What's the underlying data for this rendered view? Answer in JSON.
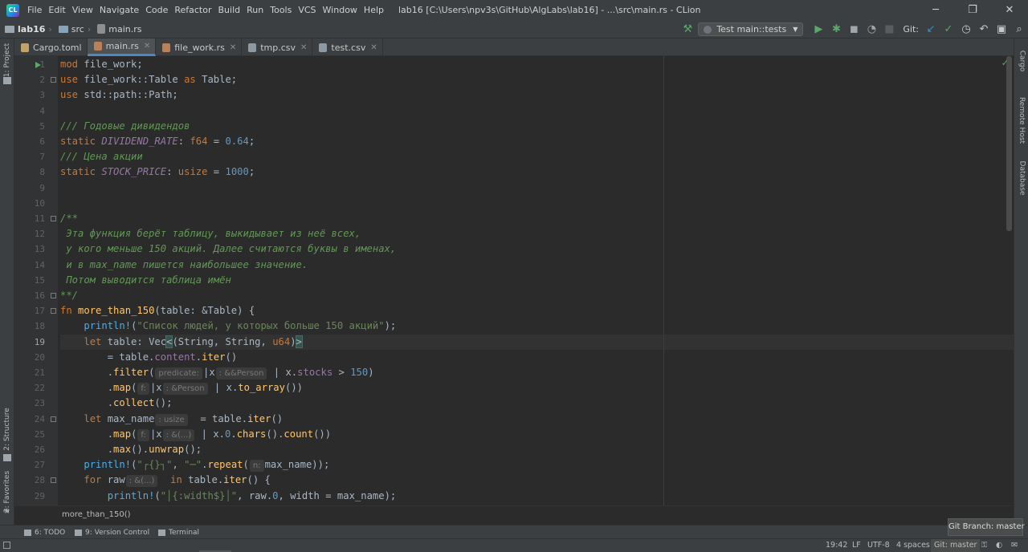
{
  "window": {
    "menus": [
      "File",
      "Edit",
      "View",
      "Navigate",
      "Code",
      "Refactor",
      "Build",
      "Run",
      "Tools",
      "VCS",
      "Window",
      "Help"
    ],
    "title": "lab16 [C:\\Users\\npv3s\\GitHub\\AlgLabs\\lab16] - ...\\src\\main.rs - CLion"
  },
  "navbar": {
    "project": "lab16",
    "folder": "src",
    "file": "main.rs",
    "run_config": "Test main::tests",
    "git_label": "Git:"
  },
  "tabs": [
    {
      "label": "Cargo.toml",
      "type": "toml"
    },
    {
      "label": "main.rs",
      "type": "rs",
      "active": true
    },
    {
      "label": "file_work.rs",
      "type": "rs"
    },
    {
      "label": "tmp.csv",
      "type": "csv"
    },
    {
      "label": "test.csv",
      "type": "csv"
    }
  ],
  "left_tools": [
    "1: Project",
    "2: Structure",
    "2: Favorites"
  ],
  "right_tools": [
    "Cargo",
    "Remote Host",
    "Database"
  ],
  "editor": {
    "current_line": 19,
    "line_numbers": [
      "1",
      "2",
      "3",
      "4",
      "5",
      "6",
      "7",
      "8",
      "9",
      "10",
      "11",
      "12",
      "13",
      "14",
      "15",
      "16",
      "17",
      "18",
      "19",
      "20",
      "21",
      "22",
      "23",
      "24",
      "25",
      "26",
      "27",
      "28",
      "29"
    ],
    "lines": [
      [
        {
          "t": "mod",
          "c": "kw"
        },
        {
          "t": " file_work;"
        }
      ],
      [
        {
          "t": "use",
          "c": "kw"
        },
        {
          "t": " file_work::Table "
        },
        {
          "t": "as",
          "c": "kw"
        },
        {
          "t": " Table;"
        }
      ],
      [
        {
          "t": "use",
          "c": "kw"
        },
        {
          "t": " std::path::Path;"
        }
      ],
      [],
      [
        {
          "t": "/// Годовые дивидендов",
          "c": "cmt"
        }
      ],
      [
        {
          "t": "static",
          "c": "kw"
        },
        {
          "t": " "
        },
        {
          "t": "DIVIDEND_RATE",
          "c": "stat"
        },
        {
          "t": ": "
        },
        {
          "t": "f64",
          "c": "kw"
        },
        {
          "t": " = "
        },
        {
          "t": "0.64",
          "c": "num"
        },
        {
          "t": ";"
        }
      ],
      [
        {
          "t": "/// Цена акции",
          "c": "cmt"
        }
      ],
      [
        {
          "t": "static",
          "c": "kw"
        },
        {
          "t": " "
        },
        {
          "t": "STOCK_PRICE",
          "c": "stat"
        },
        {
          "t": ": "
        },
        {
          "t": "usize",
          "c": "kw"
        },
        {
          "t": " = "
        },
        {
          "t": "1000",
          "c": "num"
        },
        {
          "t": ";"
        }
      ],
      [],
      [],
      [
        {
          "t": "/**",
          "c": "cmt"
        }
      ],
      [
        {
          "t": " Эта функция берёт таблицу, выкидывает из неё всех,",
          "c": "cmt"
        }
      ],
      [
        {
          "t": " у кого меньше 150 акций. Далее считаются буквы в именах,",
          "c": "cmt"
        }
      ],
      [
        {
          "t": " и в max_name пишется наибольшее значение.",
          "c": "cmt"
        }
      ],
      [
        {
          "t": " Потом выводится таблица имён",
          "c": "cmt"
        }
      ],
      [
        {
          "t": "**/",
          "c": "cmt"
        }
      ],
      [
        {
          "t": "fn",
          "c": "kw"
        },
        {
          "t": " "
        },
        {
          "t": "more_than_150",
          "c": "fn"
        },
        {
          "t": "(table: &Table) {"
        }
      ],
      [
        {
          "t": "    "
        },
        {
          "t": "println!",
          "c": "mac"
        },
        {
          "t": "("
        },
        {
          "t": "\"Список людей, у которых больше 150 акций\"",
          "c": "str"
        },
        {
          "t": ");"
        }
      ],
      [
        {
          "t": "    "
        },
        {
          "t": "let",
          "c": "kw"
        },
        {
          "t": " table: Vec"
        },
        {
          "t": "<",
          "c": "brace"
        },
        {
          "t": "(String, String, "
        },
        {
          "t": "u64",
          "c": "kw"
        },
        {
          "t": ")"
        },
        {
          "t": ">",
          "c": "brace"
        }
      ],
      [
        {
          "t": "        = table."
        },
        {
          "t": "content",
          "c": "field"
        },
        {
          "t": "."
        },
        {
          "t": "iter",
          "c": "fn"
        },
        {
          "t": "()"
        }
      ],
      [
        {
          "t": "        ."
        },
        {
          "t": "filter",
          "c": "fn"
        },
        {
          "t": "("
        },
        {
          "h": "predicate:"
        },
        {
          "t": "|x"
        },
        {
          "h": ": &&Person"
        },
        {
          "t": " | x."
        },
        {
          "t": "stocks",
          "c": "field"
        },
        {
          "t": " > "
        },
        {
          "t": "150",
          "c": "num"
        },
        {
          "t": ")"
        }
      ],
      [
        {
          "t": "        ."
        },
        {
          "t": "map",
          "c": "fn"
        },
        {
          "t": "("
        },
        {
          "h": "f:"
        },
        {
          "t": "|x"
        },
        {
          "h": ": &Person"
        },
        {
          "t": " | x."
        },
        {
          "t": "to_array",
          "c": "fn"
        },
        {
          "t": "())"
        }
      ],
      [
        {
          "t": "        ."
        },
        {
          "t": "collect",
          "c": "fn"
        },
        {
          "t": "();"
        }
      ],
      [
        {
          "t": "    "
        },
        {
          "t": "let",
          "c": "kw"
        },
        {
          "t": " max_name"
        },
        {
          "h": ": usize"
        },
        {
          "t": "  = table."
        },
        {
          "t": "iter",
          "c": "fn"
        },
        {
          "t": "()"
        }
      ],
      [
        {
          "t": "        ."
        },
        {
          "t": "map",
          "c": "fn"
        },
        {
          "t": "("
        },
        {
          "h": "f:"
        },
        {
          "t": "|x"
        },
        {
          "h": ": &(...)"
        },
        {
          "t": " | x."
        },
        {
          "t": "0",
          "c": "num"
        },
        {
          "t": "."
        },
        {
          "t": "chars",
          "c": "fn"
        },
        {
          "t": "()."
        },
        {
          "t": "count",
          "c": "fn"
        },
        {
          "t": "())"
        }
      ],
      [
        {
          "t": "        ."
        },
        {
          "t": "max",
          "c": "fn"
        },
        {
          "t": "()."
        },
        {
          "t": "unwrap",
          "c": "fn"
        },
        {
          "t": "();"
        }
      ],
      [
        {
          "t": "    "
        },
        {
          "t": "println!",
          "c": "mac"
        },
        {
          "t": "("
        },
        {
          "t": "\"┌{}┐\"",
          "c": "str"
        },
        {
          "t": ", "
        },
        {
          "t": "\"─\"",
          "c": "str"
        },
        {
          "t": "."
        },
        {
          "t": "repeat",
          "c": "fn"
        },
        {
          "t": "("
        },
        {
          "h": "n:"
        },
        {
          "t": "max_name));"
        }
      ],
      [
        {
          "t": "    "
        },
        {
          "t": "for",
          "c": "kw"
        },
        {
          "t": " raw"
        },
        {
          "h": ": &(...)"
        },
        {
          "t": "  "
        },
        {
          "t": "in",
          "c": "kw"
        },
        {
          "t": " table."
        },
        {
          "t": "iter",
          "c": "fn"
        },
        {
          "t": "() {"
        }
      ],
      [
        {
          "t": "        "
        },
        {
          "t": "println!",
          "c": "mac"
        },
        {
          "t": "("
        },
        {
          "t": "\"│{:width$}│\"",
          "c": "str"
        },
        {
          "t": ", raw."
        },
        {
          "t": "0",
          "c": "num"
        },
        {
          "t": ", width = max_name);"
        }
      ]
    ],
    "breadcrumb": "more_than_150()"
  },
  "bottom_tabs": [
    "6: TODO",
    "9: Version Control",
    "Terminal"
  ],
  "tooltip": "Git Branch: master",
  "status": {
    "position": "19:42",
    "line_sep": "LF",
    "encoding": "UTF-8",
    "indent": "4 spaces",
    "git": "Git: master"
  }
}
